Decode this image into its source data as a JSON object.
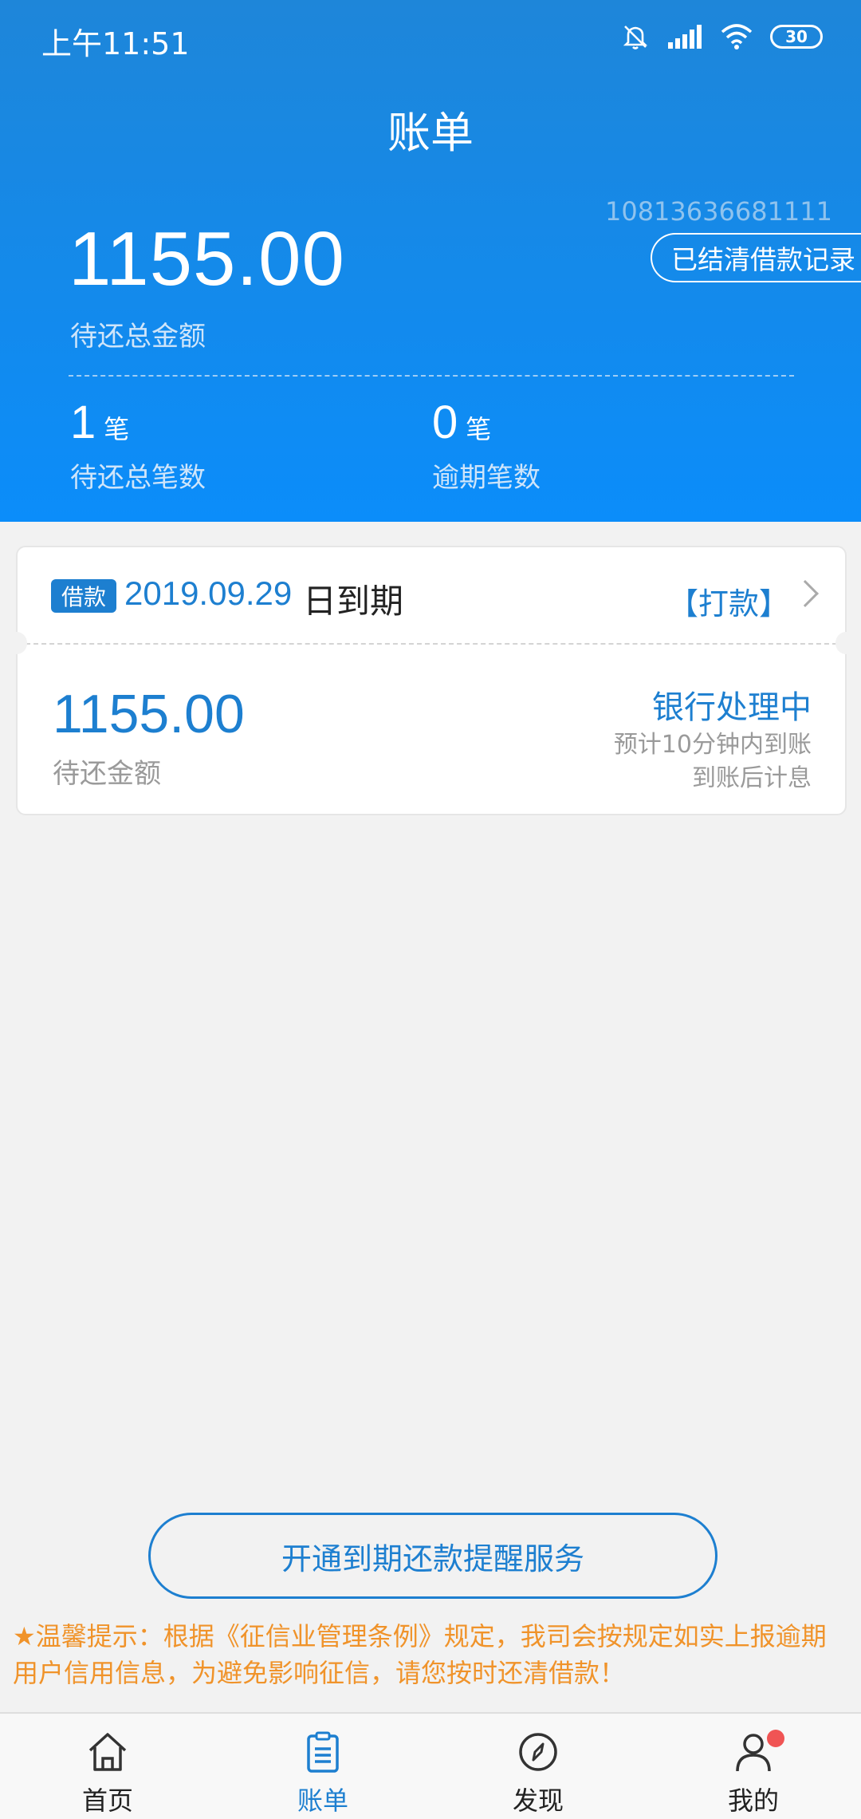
{
  "status_bar": {
    "time": "上午11:51",
    "battery": "30",
    "icons": [
      "mute-icon",
      "signal-icon",
      "wifi-icon",
      "battery-icon"
    ]
  },
  "header": {
    "title": "账单",
    "account_number": "10813636681111",
    "settled_button": "已结清借款记录",
    "total_amount": "1155.00",
    "total_label": "待还总金额",
    "stats": {
      "count": {
        "value": "1",
        "unit": "笔",
        "label": "待还总笔数"
      },
      "overdue": {
        "value": "0",
        "unit": "笔",
        "label": "逾期笔数"
      }
    }
  },
  "loan_card": {
    "tag": "借款",
    "due_date": "2019.09.29",
    "due_suffix": "日到期",
    "action": "【打款】",
    "amount": "1155.00",
    "amount_label": "待还金额",
    "status": "银行处理中",
    "eta": "预计10分钟内到账",
    "interest_note": "到账后计息"
  },
  "reminder_button": "开通到期还款提醒服务",
  "tip": "★温馨提示：根据《征信业管理条例》规定，我司会按规定如实上报逾期用户信用信息，为避免影响征信，请您按时还清借款！",
  "tab_bar": {
    "items": [
      {
        "label": "首页",
        "icon": "home-icon"
      },
      {
        "label": "账单",
        "icon": "bill-icon",
        "active": true
      },
      {
        "label": "发现",
        "icon": "compass-icon"
      },
      {
        "label": "我的",
        "icon": "profile-icon",
        "badge": true
      }
    ]
  },
  "colors": {
    "primary": "#1d7fd0",
    "header_gradient_top": "#1e86d9",
    "header_gradient_bottom": "#0b8dfa",
    "tip": "#f0932a",
    "badge": "#f05454"
  }
}
